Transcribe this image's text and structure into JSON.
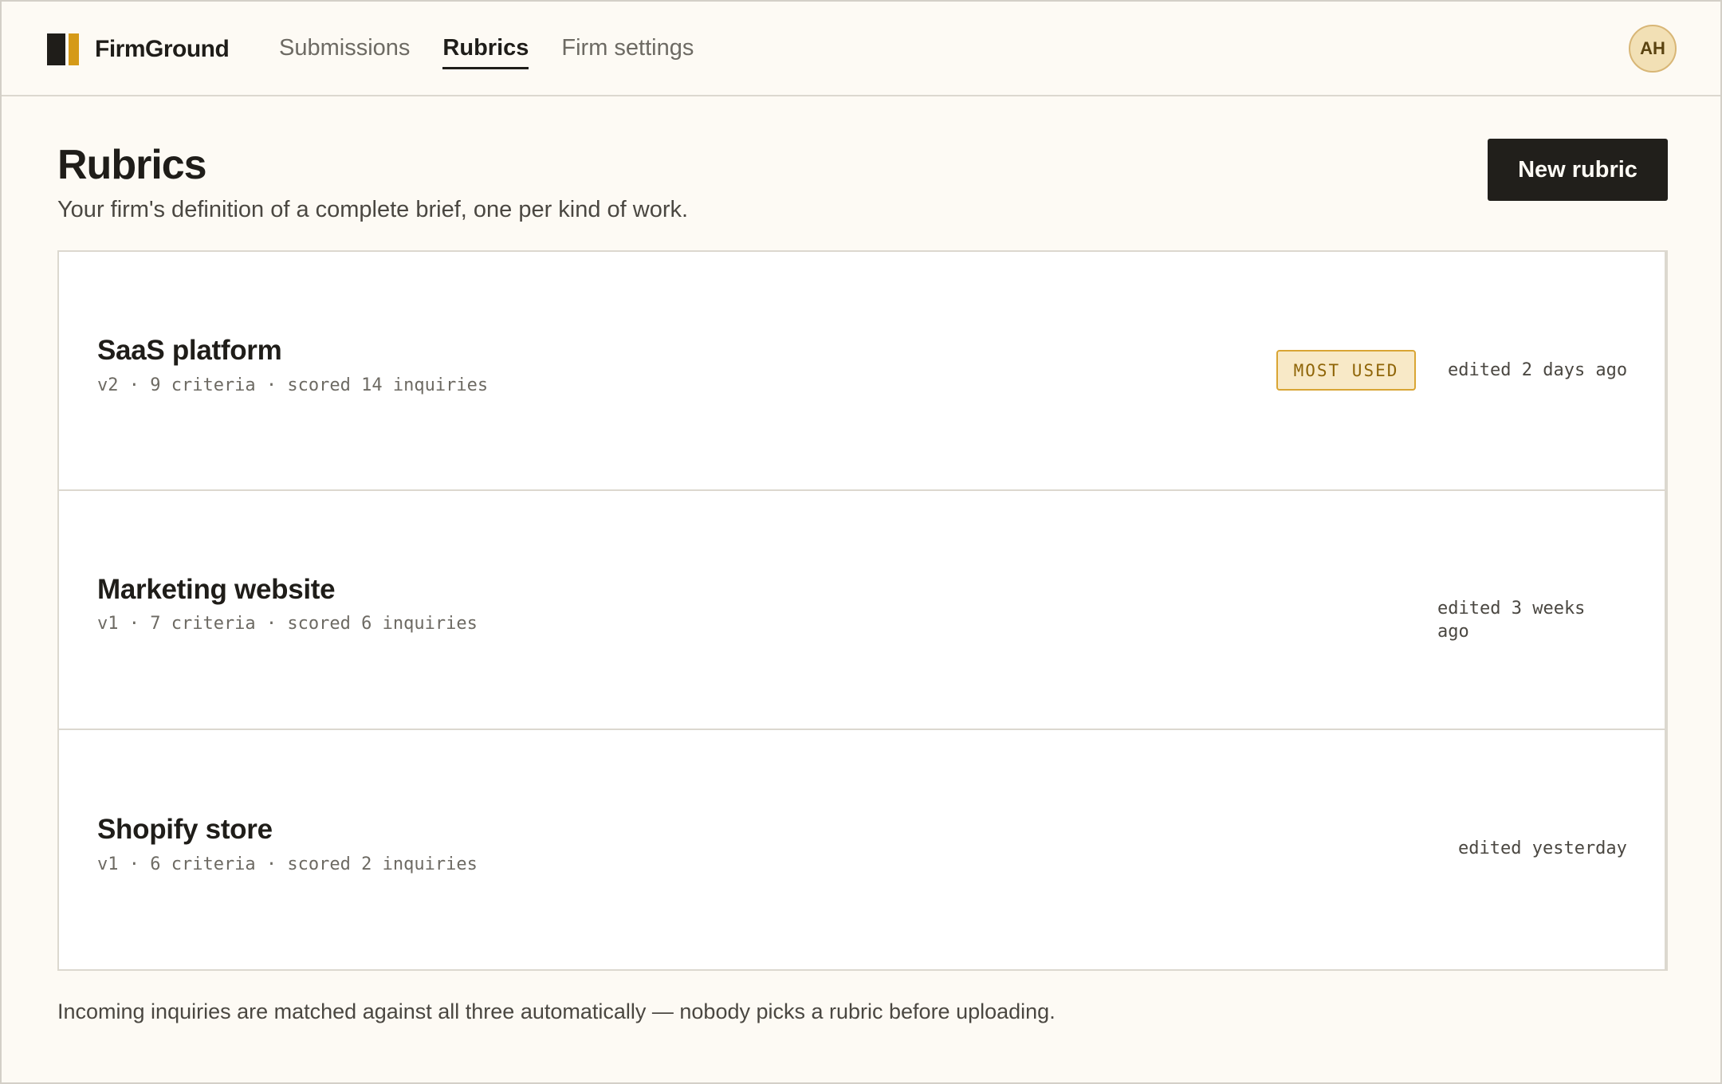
{
  "brand": {
    "name": "FirmGround"
  },
  "nav": {
    "items": [
      {
        "label": "Submissions"
      },
      {
        "label": "Rubrics"
      },
      {
        "label": "Firm settings"
      }
    ],
    "active": "Rubrics"
  },
  "user": {
    "initials": "AH"
  },
  "page": {
    "title": "Rubrics",
    "subtitle": "Your firm's definition of a complete brief, one per kind of work.",
    "new_button": "New rubric"
  },
  "rubrics": [
    {
      "name": "SaaS platform",
      "meta": "v2 · 9 criteria · scored 14 inquiries",
      "badge": "MOST USED",
      "edited": "edited 2 days ago"
    },
    {
      "name": "Marketing website",
      "meta": "v1 · 7 criteria · scored 6 inquiries",
      "badge": "",
      "edited": "edited 3 weeks ago"
    },
    {
      "name": "Shopify store",
      "meta": "v1 · 6 criteria · scored 2 inquiries",
      "badge": "",
      "edited": "edited yesterday"
    }
  ],
  "footer": {
    "note": "Incoming inquiries are matched against all three automatically — nobody picks a rubric before uploading."
  },
  "colors": {
    "background": "#fdfaf4",
    "ink": "#1f1d19",
    "accent": "#d59a18",
    "badge_bg": "#f8e9c7"
  }
}
